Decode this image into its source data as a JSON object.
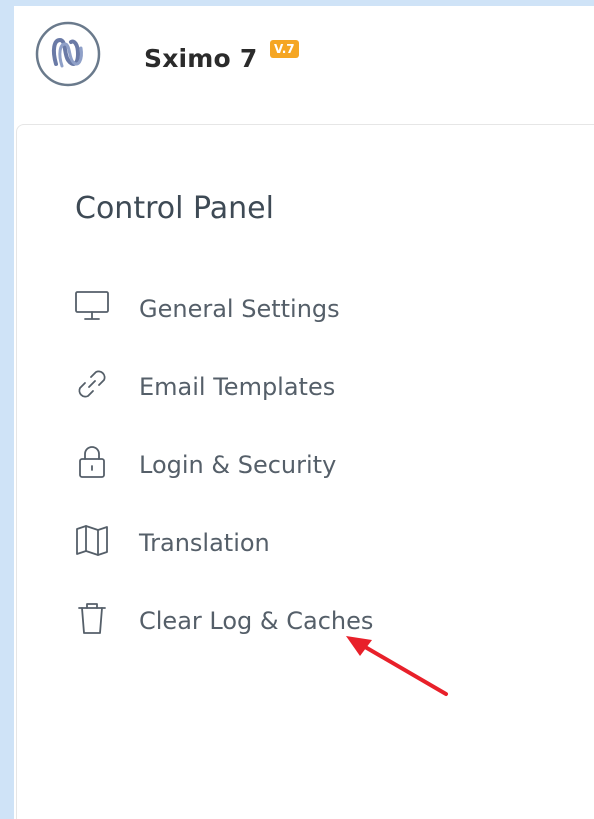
{
  "app": {
    "name": "Sximo 7",
    "version_badge": "V.7",
    "logo_icon": "sximo-logo-icon"
  },
  "panel": {
    "title": "Control Panel",
    "items": [
      {
        "label": "General Settings",
        "icon": "monitor-icon"
      },
      {
        "label": "Email Templates",
        "icon": "link-icon"
      },
      {
        "label": "Login & Security",
        "icon": "lock-icon"
      },
      {
        "label": "Translation",
        "icon": "map-icon"
      },
      {
        "label": "Clear Log & Caches",
        "icon": "trash-icon"
      }
    ]
  },
  "annotation": {
    "arrow_color": "#e8202a",
    "points_to": "Clear Log & Caches"
  },
  "colors": {
    "frame": "#cfe3f7",
    "badge": "#f5a623",
    "text": "#555f69"
  }
}
